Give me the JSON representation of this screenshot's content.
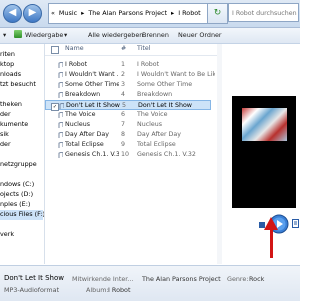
{
  "address": {
    "crumbs": [
      "«",
      "Music",
      "▸",
      "The Alan Parsons Project",
      "▸",
      "I Robot"
    ],
    "search_placeholder": "I Robot durchsuchen"
  },
  "toolbar": {
    "play_label": "Wiedergabe",
    "play_all_label": "Alle wiedergeben",
    "burn_label": "Brennen",
    "new_folder_label": "Neuer Ordner"
  },
  "sidebar": {
    "items": [
      "riten",
      "ktop",
      "nloads",
      "tzt besucht",
      "",
      "theken",
      "der",
      "kumente",
      "sik",
      "der",
      "",
      "netzgruppe",
      "",
      "ndows (C:)",
      "ojects (D:)",
      "nples (E:)",
      "cious Files (F:)",
      "",
      "verk"
    ]
  },
  "columns": {
    "name": "Name",
    "num": "#",
    "title": "Titel"
  },
  "tracks": [
    {
      "name": "I Robot",
      "num": "1",
      "title": "I Robot"
    },
    {
      "name": "I Wouldn't Want ...",
      "num": "2",
      "title": "I Wouldn't Want to Be Like Me"
    },
    {
      "name": "Some Other Time",
      "num": "3",
      "title": "Some Other Time"
    },
    {
      "name": "Breakdown",
      "num": "4",
      "title": "Breakdown"
    },
    {
      "name": "Don't Let It Show",
      "num": "5",
      "title": "Don't Let It Show"
    },
    {
      "name": "The Voice",
      "num": "6",
      "title": "The Voice"
    },
    {
      "name": "Nucleus",
      "num": "7",
      "title": "Nucleus"
    },
    {
      "name": "Day After Day",
      "num": "8",
      "title": "Day After Day"
    },
    {
      "name": "Total Eclipse",
      "num": "9",
      "title": "Total Eclipse"
    },
    {
      "name": "Genesis Ch.1. V.32",
      "num": "10",
      "title": "Genesis Ch.1. V.32"
    }
  ],
  "selected_index": 4,
  "status": {
    "name": "Don't Let It Show",
    "artists_label": "Mitwirkende Inter...",
    "artists_value": "The Alan Parsons Project",
    "genre_label": "Genre:",
    "genre_value": "Rock",
    "type": "MP3-Audioformat",
    "album_label": "Album:",
    "album_value": "I Robot"
  },
  "colors": {
    "accent": "#3f78c4",
    "selection": "#cde3f8",
    "arrow": "#d21515"
  }
}
